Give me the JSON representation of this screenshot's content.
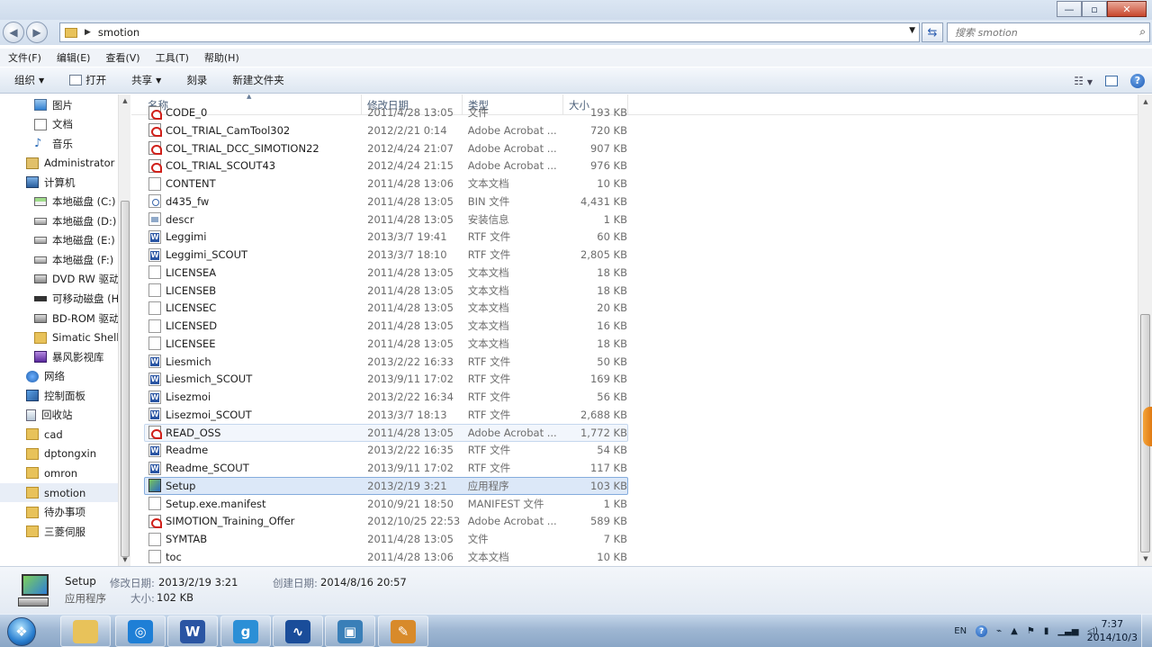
{
  "window": {
    "minimize": "—",
    "maximize": "▫",
    "close": "✕"
  },
  "address": {
    "path": "smotion",
    "search_placeholder": "搜索 smotion"
  },
  "menu": [
    "文件(F)",
    "编辑(E)",
    "查看(V)",
    "工具(T)",
    "帮助(H)"
  ],
  "toolbar": {
    "organize": "组织",
    "open": "打开",
    "share": "共享",
    "burn": "刻录",
    "new_folder": "新建文件夹"
  },
  "nav": [
    {
      "label": "图片",
      "icon": "pictures-icon",
      "indent": 2
    },
    {
      "label": "文档",
      "icon": "documents-icon",
      "indent": 2
    },
    {
      "label": "音乐",
      "icon": "music-icon",
      "indent": 2
    },
    {
      "label": "Administrator",
      "icon": "user-folder-icon",
      "indent": 1
    },
    {
      "label": "计算机",
      "icon": "computer-icon",
      "indent": 1
    },
    {
      "label": "本地磁盘 (C:)",
      "icon": "windows-drive-icon",
      "indent": 2
    },
    {
      "label": "本地磁盘 (D:)",
      "icon": "drive-icon",
      "indent": 2
    },
    {
      "label": "本地磁盘 (E:)",
      "icon": "drive-icon",
      "indent": 2
    },
    {
      "label": "本地磁盘 (F:)",
      "icon": "drive-icon",
      "indent": 2
    },
    {
      "label": "DVD RW 驱动",
      "icon": "dvd-drive-icon",
      "indent": 2
    },
    {
      "label": "可移动磁盘 (H",
      "icon": "removable-drive-icon",
      "indent": 2
    },
    {
      "label": "BD-ROM 驱动",
      "icon": "dvd-drive-icon",
      "indent": 2
    },
    {
      "label": "Simatic Shell",
      "icon": "folder-icon",
      "indent": 2
    },
    {
      "label": "暴风影视库",
      "icon": "media-library-icon",
      "indent": 2
    },
    {
      "label": "网络",
      "icon": "network-icon",
      "indent": 1
    },
    {
      "label": "控制面板",
      "icon": "control-panel-icon",
      "indent": 1
    },
    {
      "label": "回收站",
      "icon": "recycle-bin-icon",
      "indent": 1
    },
    {
      "label": "cad",
      "icon": "folder-icon",
      "indent": 1
    },
    {
      "label": "dptongxin",
      "icon": "folder-icon",
      "indent": 1
    },
    {
      "label": "omron",
      "icon": "folder-icon",
      "indent": 1
    },
    {
      "label": "smotion",
      "icon": "folder-icon",
      "indent": 1,
      "selected": true
    },
    {
      "label": "待办事项",
      "icon": "folder-icon",
      "indent": 1
    },
    {
      "label": "三菱伺服",
      "icon": "folder-icon",
      "indent": 1
    }
  ],
  "columns": {
    "name": "名称",
    "date": "修改日期",
    "type": "类型",
    "size": "大小"
  },
  "files": [
    {
      "name": "CODE_0",
      "date": "2011/4/28 13:05",
      "type": "文件",
      "size": "193 KB",
      "icon": "pdf-icon",
      "partial": true
    },
    {
      "name": "COL_TRIAL_CamTool302",
      "date": "2012/2/21 0:14",
      "type": "Adobe Acrobat ...",
      "size": "720 KB",
      "icon": "pdf-icon"
    },
    {
      "name": "COL_TRIAL_DCC_SIMOTION22",
      "date": "2012/4/24 21:07",
      "type": "Adobe Acrobat ...",
      "size": "907 KB",
      "icon": "pdf-icon"
    },
    {
      "name": "COL_TRIAL_SCOUT43",
      "date": "2012/4/24 21:15",
      "type": "Adobe Acrobat ...",
      "size": "976 KB",
      "icon": "pdf-icon"
    },
    {
      "name": "CONTENT",
      "date": "2011/4/28 13:06",
      "type": "文本文档",
      "size": "10 KB",
      "icon": "text-file-icon"
    },
    {
      "name": "d435_fw",
      "date": "2011/4/28 13:05",
      "type": "BIN 文件",
      "size": "4,431 KB",
      "icon": "bin-file-icon"
    },
    {
      "name": "descr",
      "date": "2011/4/28 13:05",
      "type": "安装信息",
      "size": "1 KB",
      "icon": "setup-info-icon"
    },
    {
      "name": "Leggimi",
      "date": "2013/3/7 19:41",
      "type": "RTF 文件",
      "size": "60 KB",
      "icon": "rtf-file-icon"
    },
    {
      "name": "Leggimi_SCOUT",
      "date": "2013/3/7 18:10",
      "type": "RTF 文件",
      "size": "2,805 KB",
      "icon": "rtf-file-icon"
    },
    {
      "name": "LICENSEA",
      "date": "2011/4/28 13:05",
      "type": "文本文档",
      "size": "18 KB",
      "icon": "text-file-icon"
    },
    {
      "name": "LICENSEB",
      "date": "2011/4/28 13:05",
      "type": "文本文档",
      "size": "18 KB",
      "icon": "text-file-icon"
    },
    {
      "name": "LICENSEC",
      "date": "2011/4/28 13:05",
      "type": "文本文档",
      "size": "20 KB",
      "icon": "text-file-icon"
    },
    {
      "name": "LICENSED",
      "date": "2011/4/28 13:05",
      "type": "文本文档",
      "size": "16 KB",
      "icon": "text-file-icon"
    },
    {
      "name": "LICENSEE",
      "date": "2011/4/28 13:05",
      "type": "文本文档",
      "size": "18 KB",
      "icon": "text-file-icon"
    },
    {
      "name": "Liesmich",
      "date": "2013/2/22 16:33",
      "type": "RTF 文件",
      "size": "50 KB",
      "icon": "rtf-file-icon"
    },
    {
      "name": "Liesmich_SCOUT",
      "date": "2013/9/11 17:02",
      "type": "RTF 文件",
      "size": "169 KB",
      "icon": "rtf-file-icon"
    },
    {
      "name": "Lisezmoi",
      "date": "2013/2/22 16:34",
      "type": "RTF 文件",
      "size": "56 KB",
      "icon": "rtf-file-icon"
    },
    {
      "name": "Lisezmoi_SCOUT",
      "date": "2013/3/7 18:13",
      "type": "RTF 文件",
      "size": "2,688 KB",
      "icon": "rtf-file-icon"
    },
    {
      "name": "READ_OSS",
      "date": "2011/4/28 13:05",
      "type": "Adobe Acrobat ...",
      "size": "1,772 KB",
      "icon": "pdf-icon",
      "hover": true
    },
    {
      "name": "Readme",
      "date": "2013/2/22 16:35",
      "type": "RTF 文件",
      "size": "54 KB",
      "icon": "rtf-file-icon"
    },
    {
      "name": "Readme_SCOUT",
      "date": "2013/9/11 17:02",
      "type": "RTF 文件",
      "size": "117 KB",
      "icon": "rtf-file-icon"
    },
    {
      "name": "Setup",
      "date": "2013/2/19 3:21",
      "type": "应用程序",
      "size": "103 KB",
      "icon": "setup-exe-icon",
      "selected": true
    },
    {
      "name": "Setup.exe.manifest",
      "date": "2010/9/21 18:50",
      "type": "MANIFEST 文件",
      "size": "1 KB",
      "icon": "text-file-icon"
    },
    {
      "name": "SIMOTION_Training_Offer",
      "date": "2012/10/25 22:53",
      "type": "Adobe Acrobat ...",
      "size": "589 KB",
      "icon": "pdf-icon"
    },
    {
      "name": "SYMTAB",
      "date": "2011/4/28 13:05",
      "type": "文件",
      "size": "7 KB",
      "icon": "text-file-icon"
    },
    {
      "name": "toc",
      "date": "2011/4/28 13:06",
      "type": "文本文档",
      "size": "10 KB",
      "icon": "text-file-icon"
    }
  ],
  "details": {
    "name": "Setup",
    "kind": "应用程序",
    "modified_label": "修改日期:",
    "modified_value": "2013/2/19 3:21",
    "created_label": "创建日期:",
    "created_value": "2014/8/16 20:57",
    "size_label": "大小:",
    "size_value": "102 KB"
  },
  "taskbar": {
    "apps": [
      {
        "name": "explorer-taskbar-icon",
        "glyph": "",
        "color": "#e8c25a"
      },
      {
        "name": "browser-taskbar-icon",
        "glyph": "◎",
        "color": "#1e7fd6"
      },
      {
        "name": "word-taskbar-icon",
        "glyph": "W",
        "color": "#2a55a3"
      },
      {
        "name": "qq-taskbar-icon",
        "glyph": "g",
        "color": "#2b8fd6"
      },
      {
        "name": "scout-taskbar-icon",
        "glyph": "∿",
        "color": "#1a4d9a"
      },
      {
        "name": "screen-taskbar-icon",
        "glyph": "▣",
        "color": "#3a7fb8"
      },
      {
        "name": "paint-taskbar-icon",
        "glyph": "✎",
        "color": "#d88a2a"
      }
    ],
    "lang": "EN",
    "time": "7:37",
    "date": "2014/10/3"
  }
}
